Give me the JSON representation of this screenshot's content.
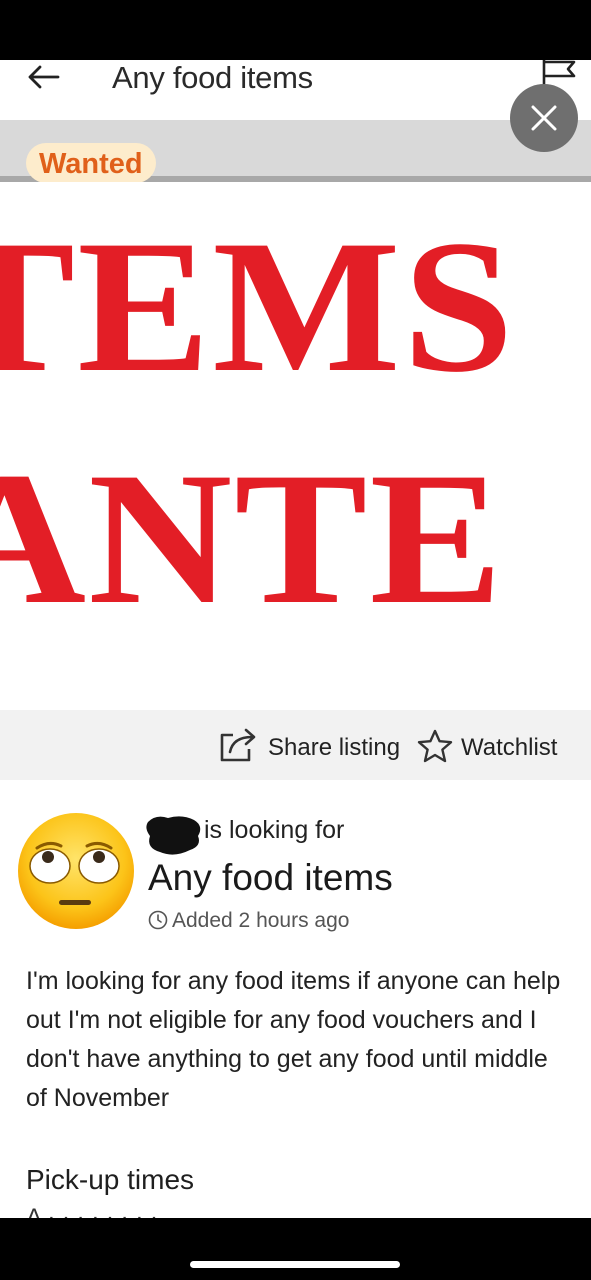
{
  "header": {
    "title": "Any food items",
    "back_icon": "arrow-left-icon",
    "flag_icon": "flag-icon"
  },
  "overlay": {
    "close_icon": "close-icon"
  },
  "badge": {
    "label": "Wanted",
    "color": "#e0601a",
    "background": "#fdeccc"
  },
  "hero_image": {
    "line1": "TEMS",
    "line2": "ANTE",
    "text_color": "#e31e26"
  },
  "actions": {
    "share_label": "Share listing",
    "watchlist_label": "Watchlist"
  },
  "listing": {
    "poster_suffix": "is looking for",
    "title": "Any food items",
    "added": "Added 2 hours ago",
    "description": "I'm looking for any food items if anyone can help out I'm not eligible for any food vouchers and I don't have anything to get any food until middle of November"
  },
  "pickup": {
    "title": "Pick-up times",
    "peek": "A  · ·  ·  ·  ·  · ·  ·"
  }
}
